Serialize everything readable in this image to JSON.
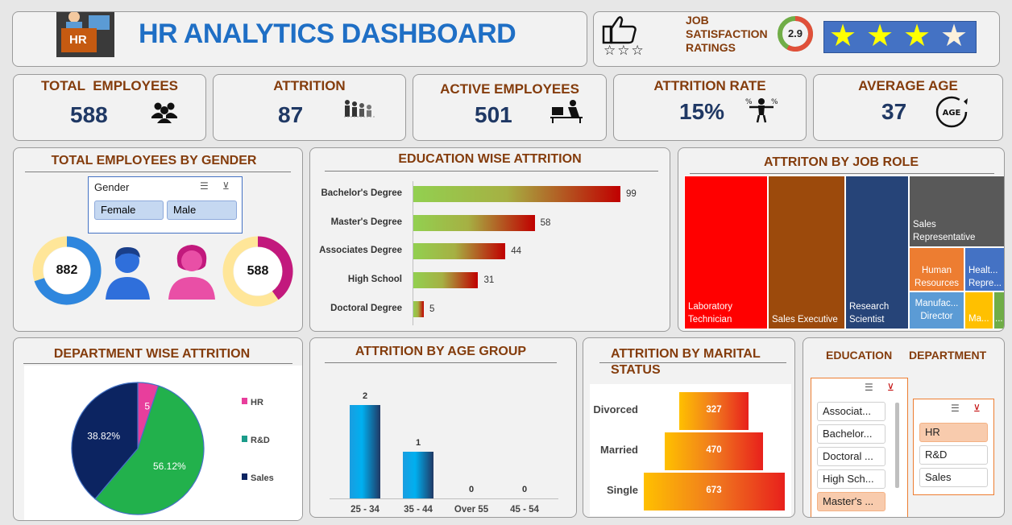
{
  "header": {
    "title": "HR ANALYTICS DASHBOARD",
    "logo_text": "HR",
    "job_sat_label": "JOB SATISFACTION RATINGS",
    "job_sat_value": "2.9",
    "job_sat_fraction": 0.58,
    "stars_filled": 3,
    "stars_total": 4
  },
  "kpis": [
    {
      "title": "TOTAL  EMPLOYEES",
      "value": "588",
      "icon": "people-group-icon"
    },
    {
      "title": "ATTRITION",
      "value": "87",
      "icon": "people-leaving-icon"
    },
    {
      "title": "ACTIVE EMPLOYEES",
      "value": "501",
      "icon": "employee-at-desk-icon"
    },
    {
      "title": "ATTRITION RATE",
      "value": "15%",
      "icon": "percent-scale-icon"
    },
    {
      "title": "AVERAGE AGE",
      "value": "37",
      "icon": "age-arrow-icon"
    }
  ],
  "gender": {
    "title": "TOTAL EMPLOYEES BY GENDER",
    "slicer_title": "Gender",
    "options": [
      "Female",
      "Male"
    ],
    "male_count": "882",
    "female_count": "588",
    "male_fraction": 0.7,
    "female_fraction": 0.4
  },
  "education": {
    "title": "EDUCATION WISE ATTRITION",
    "chart_data": {
      "type": "bar",
      "orientation": "horizontal",
      "categories": [
        "Bachelor's Degree",
        "Master's Degree",
        "Associates Degree",
        "High School",
        "Doctoral Degree"
      ],
      "values": [
        99,
        58,
        44,
        31,
        5
      ]
    }
  },
  "job_role": {
    "title": "ATTRITON BY JOB ROLE",
    "cells": [
      {
        "label": "Laboratory Technician",
        "color": "#ff0000"
      },
      {
        "label": "Sales Executive",
        "color": "#9c4a0c"
      },
      {
        "label": "Research Scientist",
        "color": "#264478"
      },
      {
        "label": "Sales Representative",
        "color": "#595959"
      },
      {
        "label": "Human Resources",
        "color": "#ed7d31"
      },
      {
        "label": "Healt... Repre...",
        "color": "#4472c4"
      },
      {
        "label": "Manufac... Director",
        "color": "#5b9bd5"
      },
      {
        "label": "Ma...",
        "color": "#ffc000"
      },
      {
        "label": "...",
        "color": "#70ad47"
      }
    ]
  },
  "department": {
    "title": "DEPARTMENT WISE ATTRITION",
    "chart_data": {
      "type": "pie",
      "categories": [
        "HR",
        "R&D",
        "Sales"
      ],
      "values": [
        5.06,
        56.12,
        38.82
      ],
      "labels": [
        "5.06%",
        "56.12%",
        "38.82%"
      ],
      "colors": [
        "#e83e9c",
        "#22b14c",
        "#0c2461"
      ],
      "legend_markers": [
        "#e83e9c",
        "#1b9c8a",
        "#0c2461"
      ]
    }
  },
  "age_group": {
    "title": "ATTRITION BY AGE GROUP",
    "chart_data": {
      "type": "bar",
      "categories": [
        "25 - 34",
        "35 - 44",
        "Over 55",
        "45 - 54"
      ],
      "values": [
        2,
        1,
        0,
        0
      ]
    }
  },
  "marital": {
    "title": "ATTRITION BY MARITAL STATUS",
    "chart_data": {
      "type": "bar",
      "orientation": "funnel",
      "categories": [
        "Divorced",
        "Married",
        "Single"
      ],
      "values": [
        327,
        470,
        673
      ]
    }
  },
  "filters": {
    "education_label": "EDUCATION",
    "department_label": "DEPARTMENT",
    "education_items": [
      "Associat...",
      "Bachelor...",
      "Doctoral ...",
      "High Sch...",
      "Master's ..."
    ],
    "education_selected": 4,
    "department_items": [
      "HR",
      "R&D",
      "Sales"
    ],
    "department_selected": 0
  }
}
